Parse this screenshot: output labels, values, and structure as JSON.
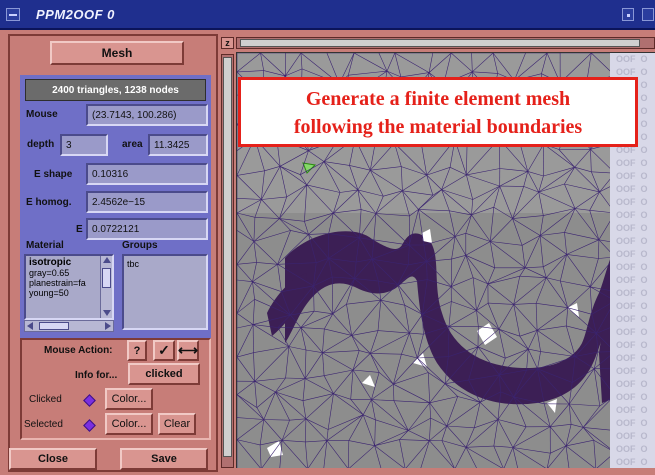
{
  "window": {
    "title": "PPM2OOF 0"
  },
  "left_panel": {
    "mesh_button": "Mesh",
    "stats": "2400 triangles, 1238 nodes",
    "mouse": {
      "label": "Mouse",
      "value": "(23.7143, 100.286)"
    },
    "depth": {
      "label": "depth",
      "value": "3"
    },
    "area": {
      "label": "area",
      "value": "11.3425"
    },
    "e_shape": {
      "label": "E shape",
      "value": "0.10316"
    },
    "e_homog": {
      "label": "E homog.",
      "value": "2.4562e−15"
    },
    "e": {
      "label": "E",
      "value": "0.0722121"
    },
    "material_label": "Material",
    "groups_label": "Groups",
    "material_items": [
      "isotropic",
      "gray=0.65",
      "planestrain=fa",
      "young=50"
    ],
    "groups_items": [
      "tbc"
    ],
    "mouse_action": {
      "label": "Mouse Action:",
      "question": "?",
      "check": "✓",
      "move": "⟷"
    },
    "info_for": {
      "label": "Info for...",
      "value": "clicked"
    },
    "clicked": {
      "label": "Clicked",
      "color_btn": "Color...",
      "color": "#7a2fe0"
    },
    "selected": {
      "label": "Selected",
      "color_btn": "Color...",
      "clear_btn": "Clear",
      "color": "#7a2fe0"
    },
    "close_button": "Close",
    "save_button": "Save"
  },
  "viewer": {
    "z_label": "z",
    "callout": [
      "Generate a finite element mesh",
      "following the material boundaries"
    ],
    "side_strip_text": "OOF"
  },
  "colors": {
    "titlebar": "#1f2f8e",
    "panel_blue": "#6f6fc7",
    "frame": "#c77d78",
    "mesh_line": "#3b2470",
    "dark_material": "#3c1f55",
    "callout_red": "#e5211a"
  }
}
